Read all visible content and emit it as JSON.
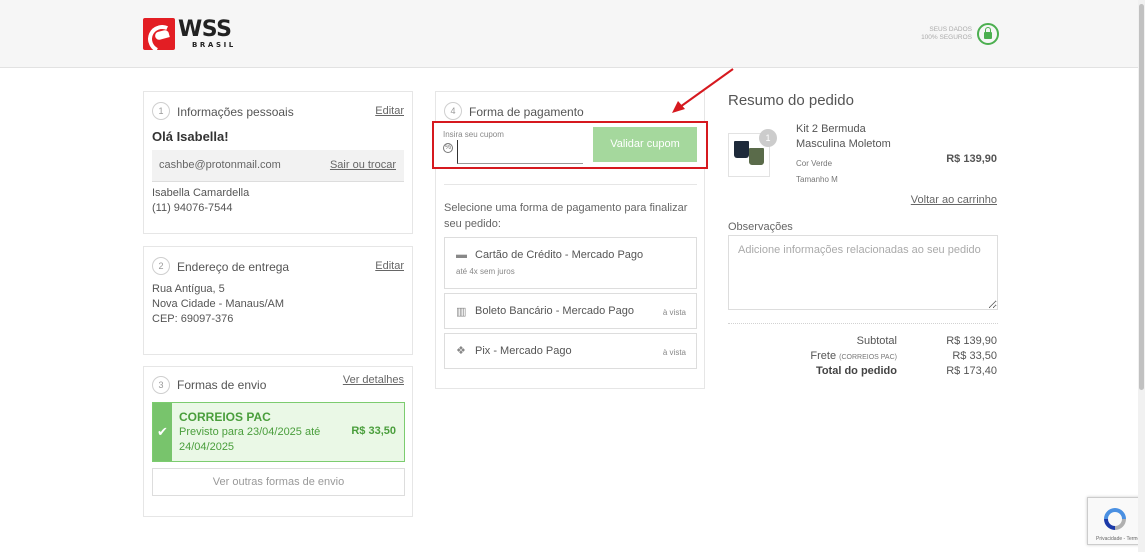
{
  "header": {
    "logo_main": "WSS",
    "logo_sub": "BRASIL",
    "secure_line1": "SEUS DADOS",
    "secure_line2": "100% SEGUROS"
  },
  "personal": {
    "step": "1",
    "title": "Informações pessoais",
    "edit": "Editar",
    "greeting": "Olá Isabella!",
    "email": "cashbe@protonmail.com",
    "switch": "Sair ou trocar",
    "name": "Isabella Camardella",
    "phone": "(11) 94076-7544"
  },
  "address": {
    "step": "2",
    "title": "Endereço de entrega",
    "edit": "Editar",
    "street": "Rua Antígua, 5",
    "city": "Nova Cidade - Manaus/AM",
    "cep": "CEP: 69097-376"
  },
  "shipping": {
    "step": "3",
    "title": "Formas de envio",
    "details": "Ver detalhes",
    "option_name": "CORREIOS PAC",
    "option_date": "Previsto para 23/04/2025 até 24/04/2025",
    "option_price": "R$ 33,50",
    "other": "Ver outras formas de envio"
  },
  "payment": {
    "step": "4",
    "title": "Forma de pagamento",
    "coupon_label": "Insira seu cupom",
    "coupon_value": "",
    "coupon_button": "Validar cupom",
    "instruction": "Selecione uma forma de pagamento para finalizar seu pedido:",
    "options": [
      {
        "name": "Cartão de Crédito - Mercado Pago",
        "sub": "até 4x sem juros",
        "right": ""
      },
      {
        "name": "Boleto Bancário - Mercado Pago",
        "sub": "",
        "right": "à vista"
      },
      {
        "name": "Pix - Mercado Pago",
        "sub": "",
        "right": "à vista"
      }
    ]
  },
  "summary": {
    "title": "Resumo do pedido",
    "qty": "1",
    "product_name": "Kit 2 Bermuda Masculina Moletom",
    "color": "Cor Verde",
    "size": "Tamanho M",
    "price": "R$ 139,90",
    "back": "Voltar ao carrinho",
    "obs_label": "Observações",
    "obs_placeholder": "Adicione informações relacionadas ao seu pedido",
    "subtotal_label": "Subtotal",
    "subtotal": "R$ 139,90",
    "frete_label": "Frete",
    "frete_method": "(CORREIOS PAC)",
    "frete": "R$ 33,50",
    "total_label": "Total do pedido",
    "total": "R$ 173,40"
  },
  "recaptcha": {
    "text": "Privacidade - Termos"
  }
}
